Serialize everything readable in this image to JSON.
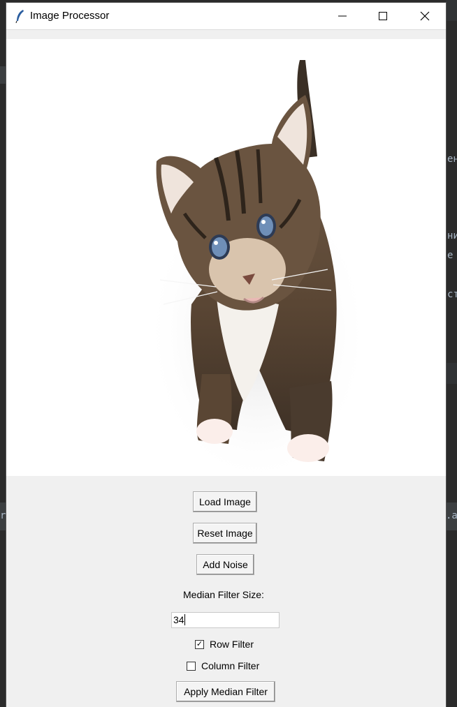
{
  "window": {
    "title": "Image Processor",
    "minimize_icon": "minimize-icon",
    "maximize_icon": "maximize-icon",
    "close_icon": "close-icon",
    "app_icon": "feather-icon"
  },
  "background": {
    "fragments": [
      "eн",
      "ни",
      "e",
      "ст",
      "r",
      ".ai"
    ]
  },
  "canvas": {
    "image": "kitten photo"
  },
  "controls": {
    "load_label": "Load Image",
    "reset_label": "Reset Image",
    "noise_label": "Add Noise",
    "median_label": "Median Filter Size:",
    "median_value": "34",
    "row_filter_label": "Row Filter",
    "row_filter_checked": true,
    "column_filter_label": "Column Filter",
    "column_filter_checked": false,
    "apply_label": "Apply Median Filter"
  }
}
